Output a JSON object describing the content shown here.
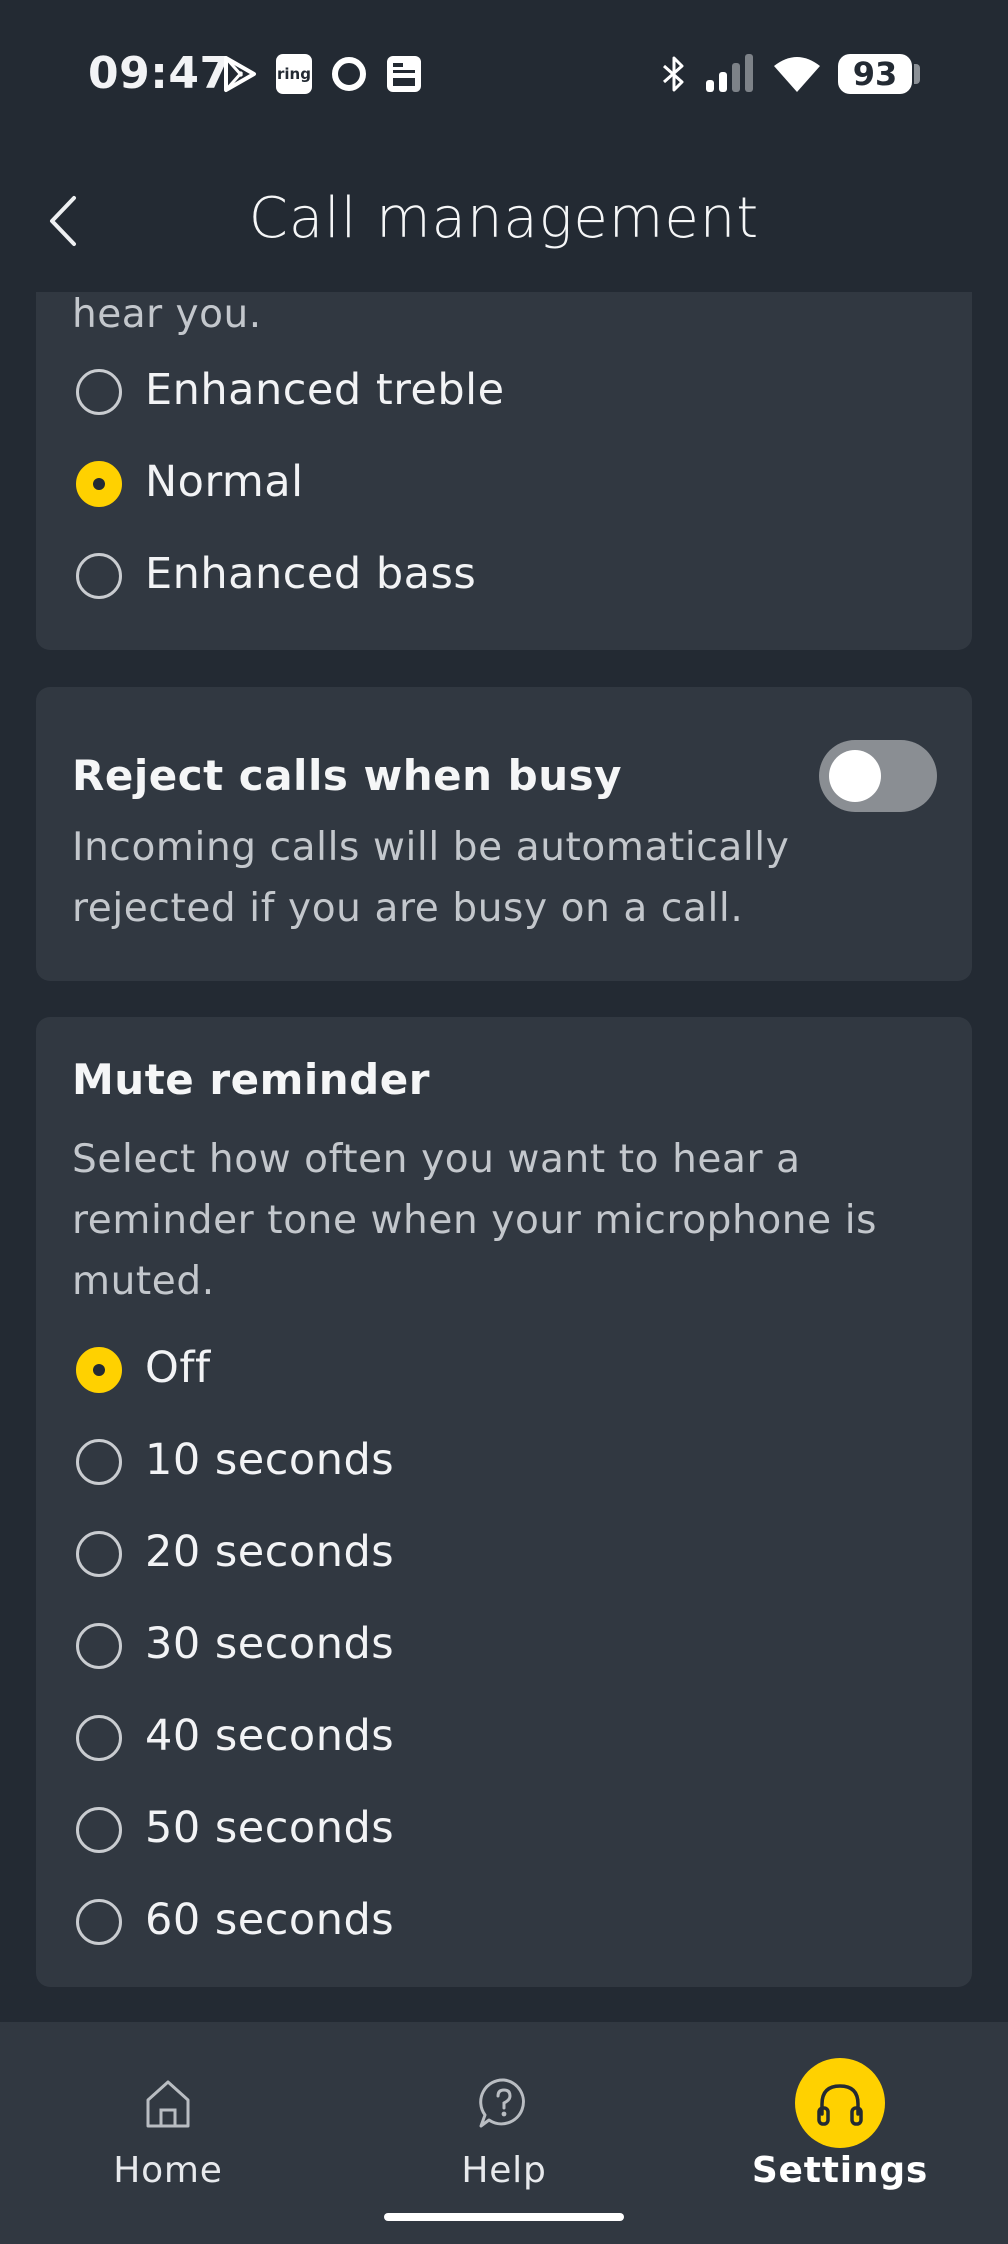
{
  "status_bar": {
    "time": "09:47",
    "battery": "93",
    "left_icons": [
      "play-store-icon",
      "ring-icon",
      "circle-app-icon",
      "calendar-app-icon"
    ],
    "ring_text": "ring",
    "right_icons": [
      "bluetooth-icon",
      "signal-icon",
      "wifi-icon",
      "battery-icon"
    ]
  },
  "header": {
    "title": "Call management",
    "back_icon": "chevron-left-icon"
  },
  "sidetone_card": {
    "clipped_text": "hear you.",
    "options": [
      {
        "label": "Enhanced treble",
        "selected": false
      },
      {
        "label": "Normal",
        "selected": true
      },
      {
        "label": "Enhanced bass",
        "selected": false
      }
    ]
  },
  "reject_card": {
    "title": "Reject calls when busy",
    "description": "Incoming calls will be automatically rejected if you are busy on a call.",
    "toggle_on": false
  },
  "mute_card": {
    "title": "Mute reminder",
    "description": "Select how often you want to hear a reminder tone when your microphone is muted.",
    "options": [
      {
        "label": "Off",
        "selected": true
      },
      {
        "label": "10 seconds",
        "selected": false
      },
      {
        "label": "20 seconds",
        "selected": false
      },
      {
        "label": "30 seconds",
        "selected": false
      },
      {
        "label": "40 seconds",
        "selected": false
      },
      {
        "label": "50 seconds",
        "selected": false
      },
      {
        "label": "60 seconds",
        "selected": false
      }
    ]
  },
  "bottom_nav": {
    "items": [
      {
        "label": "Home",
        "icon": "home-icon",
        "active": false
      },
      {
        "label": "Help",
        "icon": "help-icon",
        "active": false
      },
      {
        "label": "Settings",
        "icon": "headphones-icon",
        "active": true
      }
    ]
  },
  "colors": {
    "background": "#232a33",
    "card": "#313841",
    "accent": "#ffd100",
    "text": "#f2f3f5",
    "secondary_text": "#c3c7cc"
  }
}
